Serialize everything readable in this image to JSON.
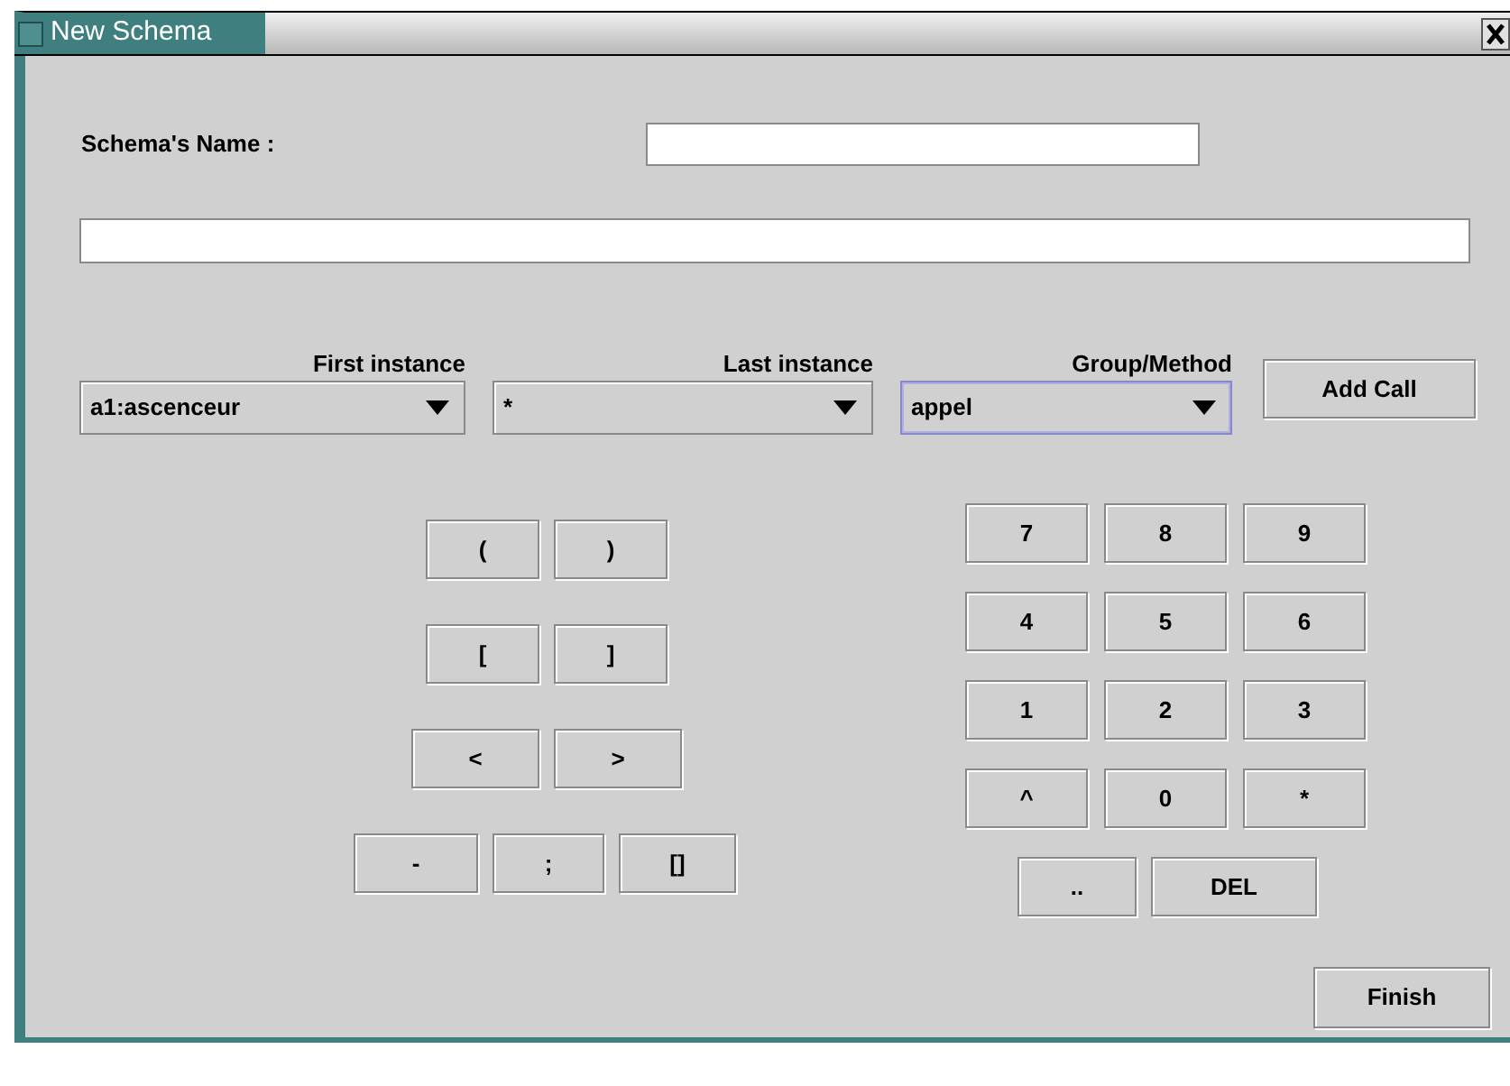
{
  "window": {
    "title": "New Schema"
  },
  "name_label": "Schema's Name :",
  "combos": [
    {
      "label": "First instance",
      "value": "a1:ascenceur",
      "focused": false
    },
    {
      "label": "Last instance",
      "value": "*",
      "focused": false
    },
    {
      "label": "Group/Method",
      "value": "appel",
      "focused": true
    }
  ],
  "add_call_button": "Add Call",
  "symbol_keys": [
    [
      "(",
      ")"
    ],
    [
      "[",
      "]"
    ],
    [
      "<",
      ">"
    ],
    [
      "-",
      ";",
      "[]"
    ]
  ],
  "number_keys": [
    [
      "7",
      "8",
      "9"
    ],
    [
      "4",
      "5",
      "6"
    ],
    [
      "1",
      "2",
      "3"
    ],
    [
      "^",
      "0",
      "*"
    ],
    [
      "..",
      "DEL"
    ]
  ],
  "finish_button": "Finish"
}
